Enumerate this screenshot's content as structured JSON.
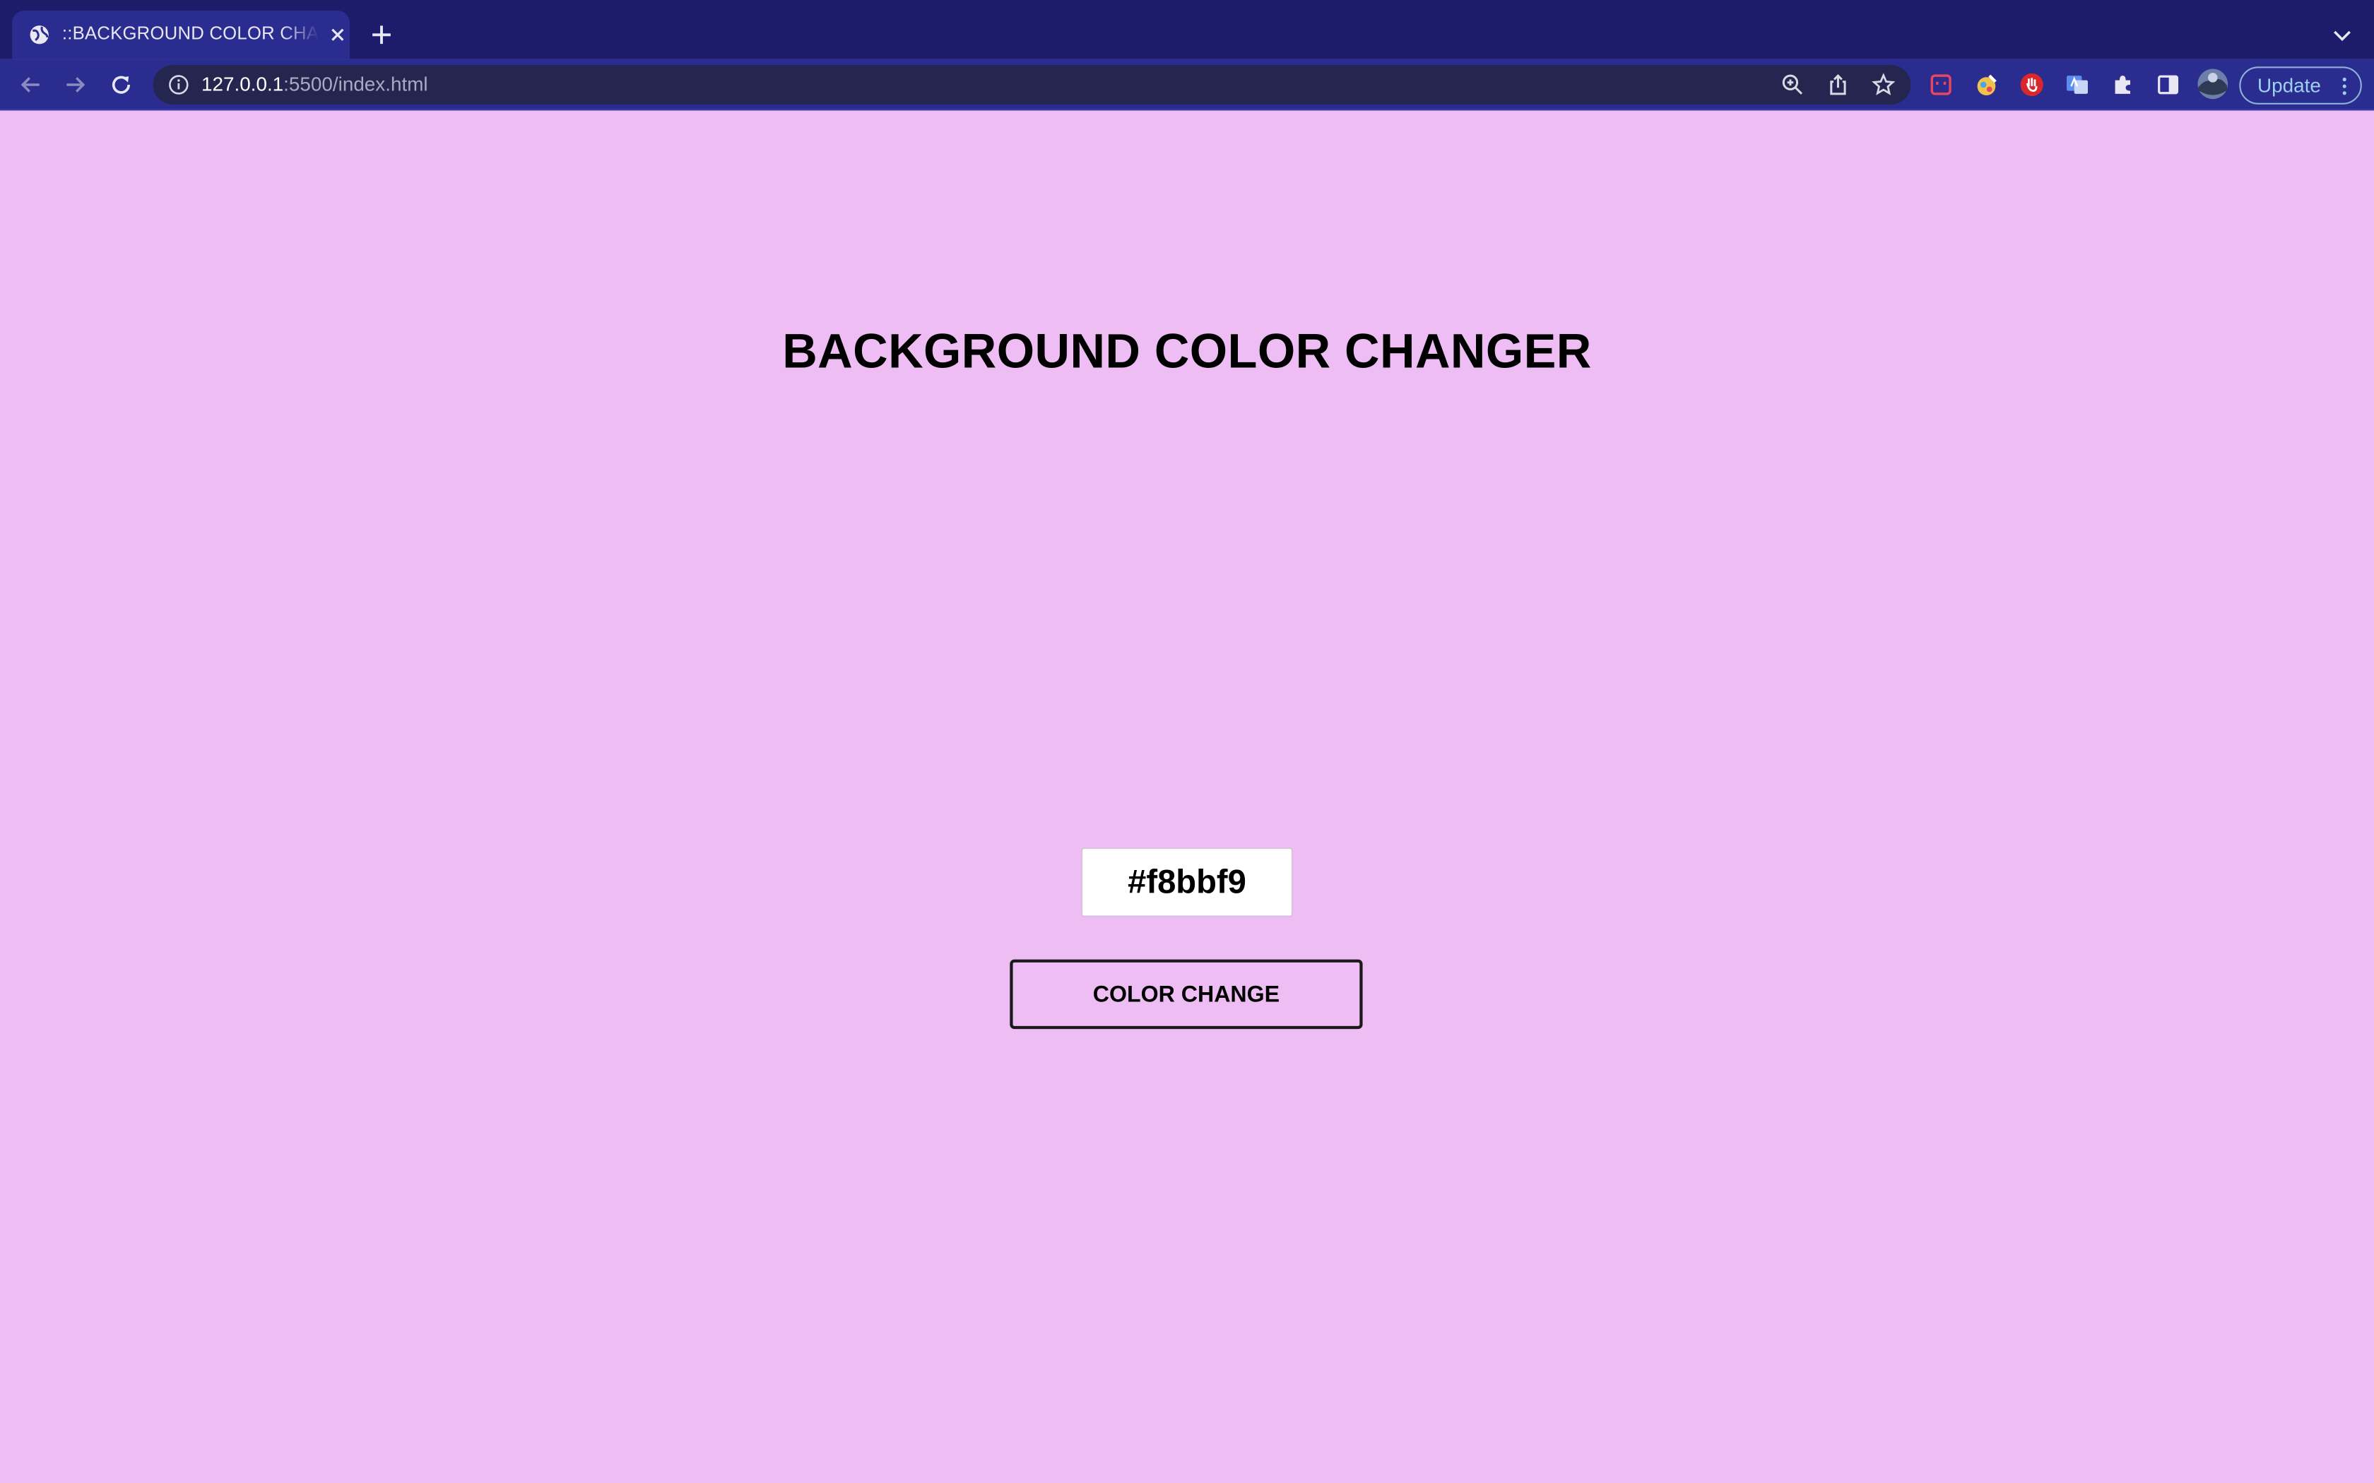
{
  "browser": {
    "tab": {
      "title": "::BACKGROUND COLOR CHANGER"
    },
    "address": {
      "host": "127.0.0.1",
      "rest": ":5500/index.html"
    },
    "update_label": "Update"
  },
  "page": {
    "heading": "BACKGROUND COLOR CHANGER",
    "color_code": "#f8bbf9",
    "button_label": "COLOR CHANGE",
    "background_color": "#eebdf4"
  },
  "colors": {
    "tabstrip": "#1c1c6b",
    "toolbar": "#2b2c8f",
    "omnibox": "#25264f"
  }
}
